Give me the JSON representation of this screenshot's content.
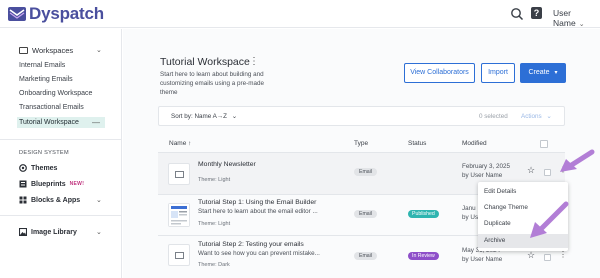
{
  "app": {
    "name": "Dyspatch",
    "logo_icon": "dyspatch-logo-icon"
  },
  "topbar": {
    "search_icon": "search-icon",
    "help_icon": "help-icon",
    "help_glyph": "?",
    "user_label": "User Name",
    "caret": "⌄"
  },
  "sidebar": {
    "header": {
      "label": "Workspaces",
      "icon": "folder-icon",
      "chevron": "⌄"
    },
    "items": [
      {
        "label": "Internal Emails"
      },
      {
        "label": "Marketing Emails"
      },
      {
        "label": "Onboarding Workspace"
      },
      {
        "label": "Transactional Emails"
      },
      {
        "label": "Tutorial Workspace",
        "active": true,
        "marker": "—"
      }
    ],
    "section_title": "DESIGN SYSTEM",
    "design_items": [
      {
        "label": "Themes",
        "icon": "themes-icon"
      },
      {
        "label": "Blueprints",
        "icon": "blueprints-icon",
        "badge": "NEW!"
      },
      {
        "label": "Blocks & Apps",
        "icon": "blocks-icon",
        "chevron": "⌄"
      }
    ],
    "library": {
      "label": "Image Library",
      "icon": "image-icon",
      "chevron": "⌄"
    }
  },
  "workspace": {
    "title": "Tutorial Workspace",
    "kebab": "⋮",
    "description": "Start here to learn about building and customizing emails using a pre-made theme",
    "buttons": {
      "collaborators": "View Collaborators",
      "import": "Import",
      "create": "Create",
      "create_caret": "▾"
    }
  },
  "filter": {
    "sort_label": "Sort by: Name A→Z",
    "sort_caret": "⌄",
    "selected": "0 selected",
    "actions": "Actions",
    "actions_caret": "⌄"
  },
  "table": {
    "columns": {
      "name": "Name",
      "name_sort": "↑",
      "type": "Type",
      "status": "Status",
      "modified": "Modified"
    },
    "rows": [
      {
        "name": "Monthly Newsletter",
        "description": "",
        "theme": "Theme: Light",
        "type": "Email",
        "status": "",
        "modified_date": "February 3, 2025",
        "modified_by": "by User Name"
      },
      {
        "name": "Tutorial Step 1: Using the Email Builder",
        "description": "Start here to learn about the email editor ...",
        "theme": "Theme: Light",
        "type": "Email",
        "status": "Published",
        "status_color": "#2fb5b0",
        "modified_date": "Janu",
        "modified_by": "by Us"
      },
      {
        "name": "Tutorial Step 2: Testing your emails",
        "description": "Want to see how you can prevent mistake...",
        "theme": "Theme: Dark",
        "type": "Email",
        "status": "In Review",
        "status_color": "#8e4fc9",
        "modified_date": "May 31, 2024",
        "modified_by": "by User Name"
      }
    ],
    "star": "☆",
    "kebab": "⋮"
  },
  "context_menu": {
    "items": [
      {
        "label": "Edit Details"
      },
      {
        "label": "Change Theme"
      },
      {
        "label": "Duplicate"
      },
      {
        "label": "Archive",
        "hover": true
      }
    ]
  },
  "colors": {
    "accent": "#2d6fd6",
    "arrow": "#b27ed6",
    "brand": "#4a4f9e"
  }
}
